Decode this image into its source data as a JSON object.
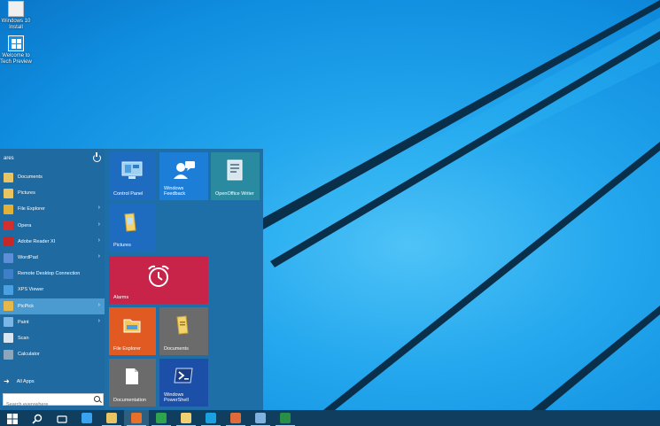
{
  "desktop": {
    "icons": [
      {
        "label": "Windows 10 Install"
      },
      {
        "label": "Welcome to Tech Preview"
      }
    ]
  },
  "start_menu": {
    "user_name": "ares",
    "apps": [
      {
        "label": "Documents",
        "icon": "folder-icon",
        "color": "#e8c560",
        "arrow": false
      },
      {
        "label": "Pictures",
        "icon": "pictures-icon",
        "color": "#e8c560",
        "arrow": false
      },
      {
        "label": "File Explorer",
        "icon": "file-explorer-icon",
        "color": "#e0b23a",
        "arrow": true
      },
      {
        "label": "Opera",
        "icon": "opera-icon",
        "color": "#d32f2f",
        "arrow": true
      },
      {
        "label": "Adobe Reader XI",
        "icon": "adobe-reader-icon",
        "color": "#c62828",
        "arrow": true
      },
      {
        "label": "WordPad",
        "icon": "wordpad-icon",
        "color": "#5c8fd6",
        "arrow": true
      },
      {
        "label": "Remote Desktop Connection",
        "icon": "remote-desktop-icon",
        "color": "#3f7fc8",
        "arrow": false
      },
      {
        "label": "XPS Viewer",
        "icon": "xps-viewer-icon",
        "color": "#4aa0e0",
        "arrow": false
      },
      {
        "label": "PicPick",
        "icon": "picpick-icon",
        "color": "#e6b84a",
        "arrow": true
      },
      {
        "label": "Paint",
        "icon": "paint-icon",
        "color": "#7ab7e8",
        "arrow": true
      },
      {
        "label": "Scan",
        "icon": "scan-icon",
        "color": "#d9e6f2",
        "arrow": false
      },
      {
        "label": "Calculator",
        "icon": "calculator-icon",
        "color": "#8ea6bc",
        "arrow": false
      }
    ],
    "highlighted_index": 8,
    "all_apps_label": "All Apps",
    "search_placeholder": "Search everywhere"
  },
  "tiles": [
    {
      "label": "Control Panel",
      "icon": "control-panel-icon",
      "color": "#1e6cc0"
    },
    {
      "label": "Windows Feedback",
      "icon": "feedback-icon",
      "color": "#1d7ed8"
    },
    {
      "label": "OpenOffice Writer",
      "icon": "openoffice-writer-icon",
      "color": "#2a8aa0"
    },
    {
      "label": "Pictures",
      "icon": "pictures-icon",
      "color": "#1e6cc0"
    },
    {
      "label": "Alarms",
      "icon": "alarm-clock-icon",
      "color": "#c8244a"
    },
    {
      "label": "File Explorer",
      "icon": "file-explorer-icon",
      "color": "#e05a22"
    },
    {
      "label": "Documents",
      "icon": "documents-icon",
      "color": "#6b6b6b"
    },
    {
      "label": "Documentation",
      "icon": "documentation-icon",
      "color": "#6b6b6b"
    },
    {
      "label": "Windows PowerShell",
      "icon": "powershell-icon",
      "color": "#1b4fa8"
    }
  ],
  "taskbar": {
    "items": [
      {
        "icon": "windows-start-icon",
        "color": "#ffffff"
      },
      {
        "icon": "search-icon",
        "color": "#ffffff"
      },
      {
        "icon": "task-view-icon",
        "color": "#ffffff"
      },
      {
        "icon": "internet-explorer-icon",
        "color": "#3aa3ef"
      },
      {
        "icon": "file-explorer-icon",
        "color": "#e8c560"
      },
      {
        "icon": "firefox-icon",
        "color": "#e8702a"
      },
      {
        "icon": "task-manager-icon",
        "color": "#2fa44f"
      },
      {
        "icon": "folder-icon",
        "color": "#f0d070"
      },
      {
        "icon": "skype-icon",
        "color": "#1aa1e1"
      },
      {
        "icon": "app-icon",
        "color": "#e06a3a"
      },
      {
        "icon": "remote-desktop-icon",
        "color": "#7fb2e0"
      },
      {
        "icon": "excel-icon",
        "color": "#2a8f46"
      }
    ]
  }
}
